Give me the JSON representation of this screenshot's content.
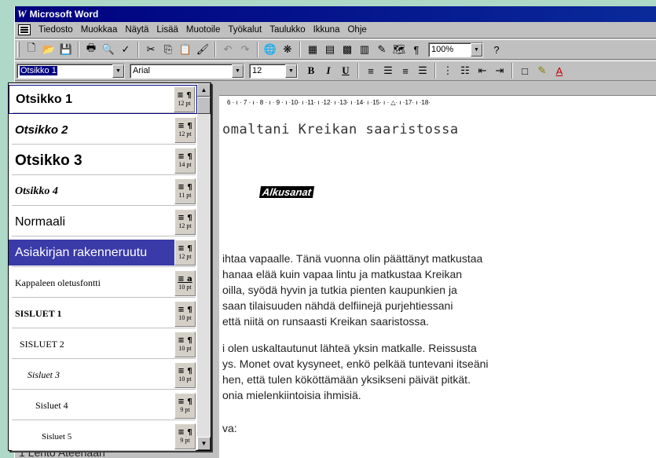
{
  "app": {
    "title": "Microsoft Word",
    "logo": "W"
  },
  "menu": [
    "Tiedosto",
    "Muokkaa",
    "Näytä",
    "Lisää",
    "Muotoile",
    "Työkalut",
    "Taulukko",
    "Ikkuna",
    "Ohje"
  ],
  "toolbar": {
    "zoom": "100%",
    "style_value": "Otsikko 1",
    "font_value": "Arial",
    "size_value": "12",
    "bold_label": "B",
    "italic_label": "I",
    "underline_label": "U"
  },
  "ruler_text": "6 · ı · 7 · ı · 8 · ı · 9 · ı ·10· ı ·11· ı ·12· ı ·13· ı ·14· ı ·15· ı · △· ı ·17· ı ·18·",
  "document": {
    "heading": "omaltani Kreikan saaristossa",
    "badge": "Alkusanat",
    "para1": [
      "ihtaa vapaalle. Tänä vuonna olin päättänyt matkustaa",
      "hanaa elää kuin vapaa lintu ja matkustaa Kreikan",
      "oilla, syödä hyvin ja tutkia pienten kaupunkien ja",
      "saan tilaisuuden nähdä delfiinejä purjehtiessani",
      "että niitä on runsaasti Kreikan saaristossa."
    ],
    "para2": [
      "i olen uskaltautunut lähteä yksin matkalle. Reissusta",
      "ys. Monet ovat kysyneet, enkö pelkää tuntevani itseäni",
      "hen, että tulen kököttämään yksikseni päivät pitkät.",
      "onia mielenkiintoisia ihmisiä."
    ],
    "para3": "va:",
    "list_peek": "1  Lento Ateenaan"
  },
  "styles": [
    {
      "name": "Otsikko 1",
      "marks": "≡ ¶",
      "size": "12 pt"
    },
    {
      "name": "Otsikko 2",
      "marks": "≡ ¶",
      "size": "12 pt"
    },
    {
      "name": "Otsikko 3",
      "marks": "≡ ¶",
      "size": "14 pt"
    },
    {
      "name": "Otsikko 4",
      "marks": "≡ ¶",
      "size": "11 pt"
    },
    {
      "name": "Normaali",
      "marks": "≡ ¶",
      "size": "12 pt"
    },
    {
      "name": "Asiakirjan rakenneruutu",
      "marks": "≡ ¶",
      "size": "12 pt"
    },
    {
      "name": "Kappaleen oletusfontti",
      "marks": "≡ a",
      "size": "10 pt"
    },
    {
      "name": "SISLUET 1",
      "marks": "≡ ¶",
      "size": "10 pt"
    },
    {
      "name": "SISLUET 2",
      "marks": "≡ ¶",
      "size": "10 pt"
    },
    {
      "name": "Sisluet 3",
      "marks": "≡ ¶",
      "size": "10 pt"
    },
    {
      "name": "Sisluet 4",
      "marks": "≡ ¶",
      "size": "9 pt"
    },
    {
      "name": "Sisluet 5",
      "marks": "≡ ¶",
      "size": "9 pt"
    }
  ]
}
